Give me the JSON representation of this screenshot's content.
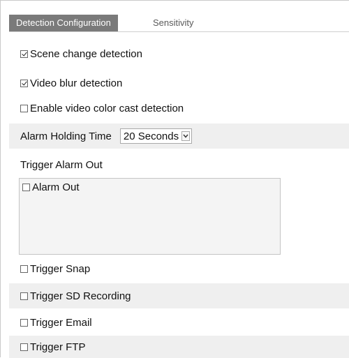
{
  "tabs": [
    {
      "label": "Detection Configuration",
      "active": true
    },
    {
      "label": "Sensitivity",
      "active": false
    }
  ],
  "options": {
    "scene_change": {
      "label": "Scene change detection",
      "checked": true
    },
    "video_blur": {
      "label": "Video blur detection",
      "checked": true
    },
    "color_cast": {
      "label": "Enable video color cast detection",
      "checked": false
    }
  },
  "alarm_holding": {
    "label": "Alarm Holding Time",
    "selected": "20 Seconds"
  },
  "trigger_alarm_out": {
    "label": "Trigger Alarm Out",
    "items": [
      {
        "label": "Alarm Out",
        "checked": false
      }
    ]
  },
  "triggers": {
    "snap": {
      "label": "Trigger Snap",
      "checked": false
    },
    "sd_recording": {
      "label": "Trigger SD Recording",
      "checked": false
    },
    "email": {
      "label": "Trigger Email",
      "checked": false
    },
    "ftp": {
      "label": "Trigger FTP",
      "checked": false
    }
  },
  "colors": {
    "active_tab_bg": "#7a7a7a",
    "shaded_row_bg": "#efefef"
  }
}
